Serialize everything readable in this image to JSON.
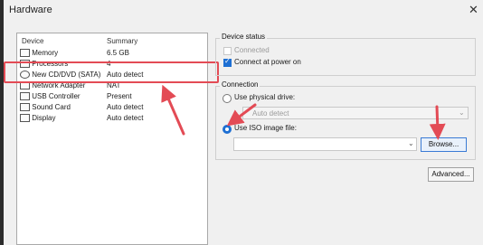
{
  "window": {
    "title": "Hardware"
  },
  "device_list": {
    "headers": {
      "device": "Device",
      "summary": "Summary"
    },
    "rows": [
      {
        "device": "Memory",
        "summary": "6.5 GB",
        "icon": "memory-icon"
      },
      {
        "device": "Processors",
        "summary": "4",
        "icon": "processor-icon"
      },
      {
        "device": "New CD/DVD (SATA)",
        "summary": "Auto detect",
        "icon": "cd-dvd-icon"
      },
      {
        "device": "Network Adapter",
        "summary": "NAT",
        "icon": "network-icon"
      },
      {
        "device": "USB Controller",
        "summary": "Present",
        "icon": "usb-icon"
      },
      {
        "device": "Sound Card",
        "summary": "Auto detect",
        "icon": "speaker-icon"
      },
      {
        "device": "Display",
        "summary": "Auto detect",
        "icon": "display-icon"
      }
    ]
  },
  "device_status": {
    "label": "Device status",
    "connected": "Connected",
    "connect_at_power_on": "Connect at power on"
  },
  "connection": {
    "label": "Connection",
    "use_physical_drive": "Use physical drive:",
    "physical_drive_value": "Auto detect",
    "use_iso_image": "Use ISO image file:",
    "iso_value": "",
    "browse_button": "Browse...",
    "advanced_button": "Advanced..."
  },
  "colors": {
    "accent": "#1d6fd3",
    "annotation": "#e34b55"
  }
}
